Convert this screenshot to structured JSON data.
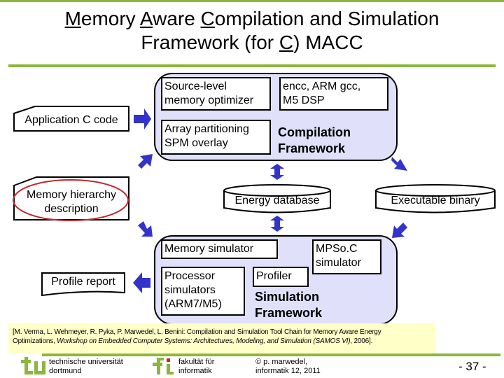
{
  "title": {
    "line1_parts": [
      {
        "text": "M",
        "underline": true
      },
      {
        "text": "emory ",
        "underline": false
      },
      {
        "text": "A",
        "underline": true
      },
      {
        "text": "ware ",
        "underline": false
      },
      {
        "text": "C",
        "underline": true
      },
      {
        "text": "ompilation and Simulation",
        "underline": false
      }
    ],
    "line2_parts": [
      {
        "text": "Framework (for ",
        "underline": false
      },
      {
        "text": "C",
        "underline": true
      },
      {
        "text": ") MACC",
        "underline": false
      }
    ]
  },
  "inputs": {
    "app_code": "Application C code",
    "memory_hierarchy_line1": "Memory hierarchy",
    "memory_hierarchy_line2": "description",
    "profile_report": "Profile report"
  },
  "compilation": {
    "source_level_line1": "Source-level",
    "source_level_line2": "memory optimizer",
    "compilers_line1": "encc, ARM gcc,",
    "compilers_line2": "M5 DSP",
    "array_part_line1": "Array partitioning",
    "array_part_line2": "SPM overlay",
    "label_line1": "Compilation",
    "label_line2": "Framework"
  },
  "databases": {
    "energy": "Energy database",
    "executable": "Executable binary"
  },
  "simulation": {
    "memory_sim": "Memory simulator",
    "mpsoc_line1": "MPSo.C",
    "mpsoc_line2": "simulator",
    "processor_line1": "Processor",
    "processor_line2": "simulators",
    "processor_line3": "(ARM7/M5)",
    "profiler": "Profiler",
    "label_line1": "Simulation",
    "label_line2": "Framework"
  },
  "citation": {
    "line1": "[M. Verma, L. Wehmeyer, R. Pyka, P. Marwedel, L. Benini: Compilation and Simulation Tool Chain for Memory Aware Energy",
    "line2_plain": "Optimizations, ",
    "line2_italic": "Workshop on Embedded Computer Systems: Architectures, Modeling, and Simulation (SAMOS VI)",
    "line2_end": ", 2006]."
  },
  "footer": {
    "tu_line1": "technische universität",
    "tu_line2": "dortmund",
    "fi_line1": "fakultät für",
    "fi_line2": "informatik",
    "copyright_line1": "© p. marwedel,",
    "copyright_line2": "informatik 12,  2011",
    "page": "- 37 -"
  },
  "colors": {
    "accent_green": "#8cb63c",
    "arrow_blue": "#3333cc",
    "frame_fill": "#e0e0fa",
    "highlight_ellipse": "#c0282c",
    "citation_bg": "#ffffc8"
  }
}
